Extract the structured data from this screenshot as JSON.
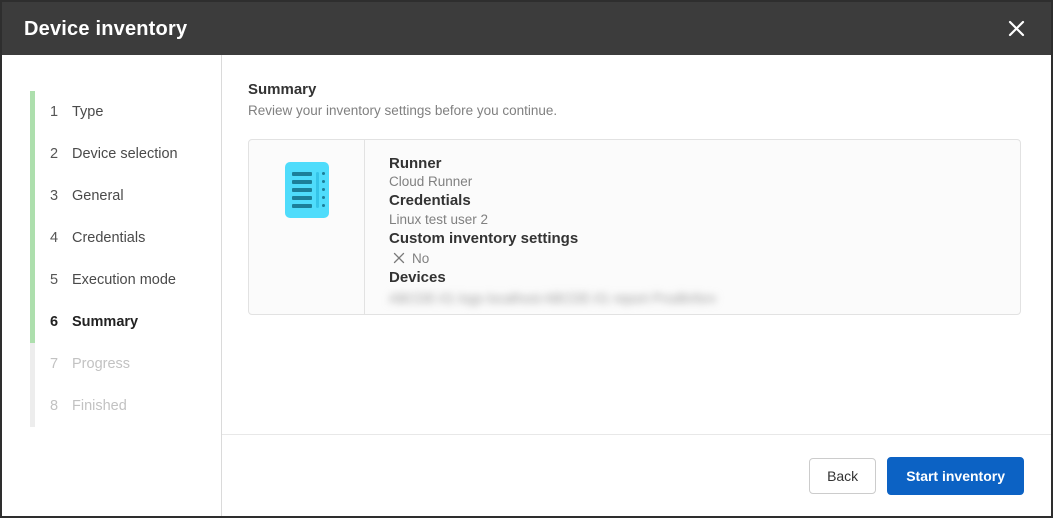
{
  "window": {
    "title": "Device inventory",
    "close_icon": "close-icon"
  },
  "sidebar": {
    "steps": [
      {
        "num": "1",
        "label": "Type",
        "state": "done"
      },
      {
        "num": "2",
        "label": "Device selection",
        "state": "done"
      },
      {
        "num": "3",
        "label": "General",
        "state": "done"
      },
      {
        "num": "4",
        "label": "Credentials",
        "state": "done"
      },
      {
        "num": "5",
        "label": "Execution mode",
        "state": "done"
      },
      {
        "num": "6",
        "label": "Summary",
        "state": "active"
      },
      {
        "num": "7",
        "label": "Progress",
        "state": "disabled"
      },
      {
        "num": "8",
        "label": "Finished",
        "state": "disabled"
      }
    ],
    "progress_color": "#addfad",
    "rail_color": "#ededed"
  },
  "main": {
    "title": "Summary",
    "subtitle": "Review your inventory settings before you continue.",
    "card": {
      "icon": "inventory-document-icon",
      "icon_color": "#4fdcfb",
      "rows": [
        {
          "key": "Runner",
          "value": "Cloud Runner"
        },
        {
          "key": "Credentials",
          "value": "Linux test user 2"
        },
        {
          "key": "Custom inventory settings",
          "value": "No",
          "flag_icon": "x-mark-icon"
        },
        {
          "key": "Devices",
          "value": "ABCDE-01 logs localhost  ABCDE-01 report  Prodlinfsrv",
          "redacted": true
        }
      ]
    }
  },
  "footer": {
    "back_label": "Back",
    "start_label": "Start inventory",
    "primary_color": "#0c62c4"
  }
}
